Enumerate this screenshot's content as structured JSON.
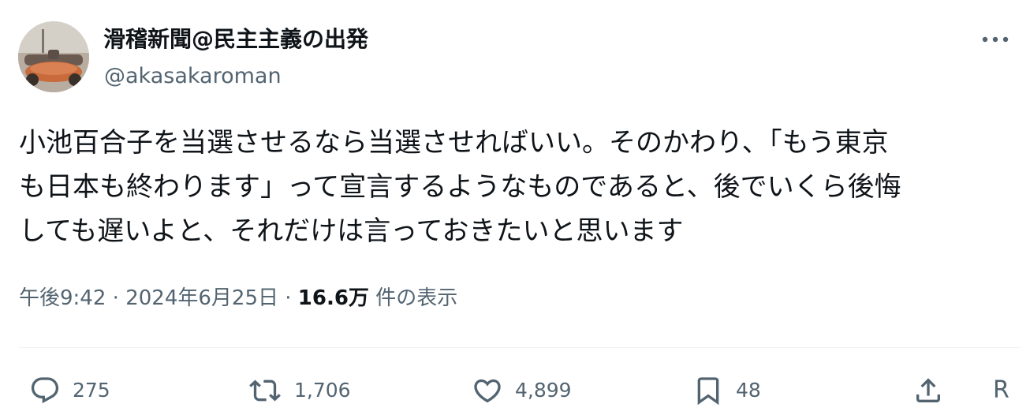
{
  "author": {
    "display_name": "滑稽新聞@民主主義の出発",
    "handle": "@akasakaroman"
  },
  "tweet": {
    "text_lines": [
      "小池百合子を当選させるなら当選させればいい。そのかわり、「もう東京",
      "も日本も終わります」って宣言するようなものであると、後でいくら後悔",
      "しても遅いよと、それだけは言っておきたいと思います"
    ],
    "time": "午後9:42",
    "separator": "·",
    "date": "2024年6月25日",
    "views_count": "16.6万",
    "views_label": "件の表示"
  },
  "actions": {
    "reply": {
      "icon": "reply-icon",
      "count": "275"
    },
    "retweet": {
      "icon": "retweet-icon",
      "count": "1,706"
    },
    "like": {
      "icon": "heart-icon",
      "count": "4,899"
    },
    "bookmark": {
      "icon": "bookmark-icon",
      "count": "48"
    },
    "share": {
      "icon": "share-icon"
    },
    "truncated_text": "R"
  },
  "colors": {
    "text": "#0f1419",
    "secondary": "#536471",
    "divider": "#eff3f4"
  }
}
